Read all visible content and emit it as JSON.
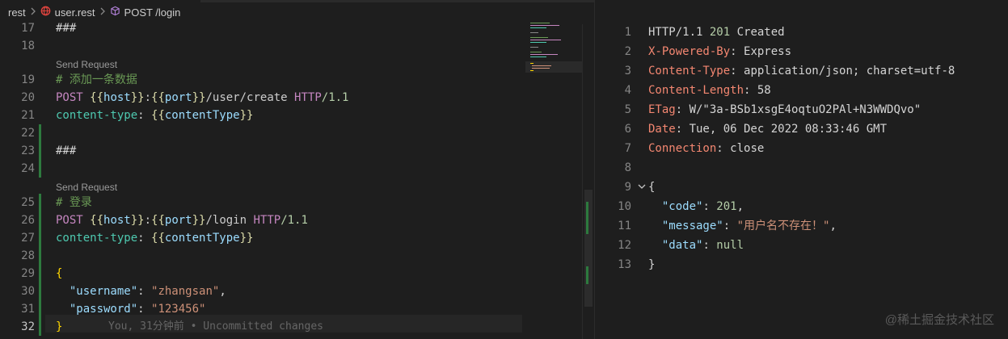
{
  "breadcrumb": {
    "items": [
      "rest",
      "user.rest",
      "POST /login"
    ],
    "icons": [
      "chevron-right-icon",
      "globe-icon",
      "cube-icon"
    ]
  },
  "editor": {
    "lines": [
      {
        "n": "17",
        "segments": [
          {
            "t": "###",
            "c": "punct"
          }
        ]
      },
      {
        "n": "18",
        "segments": []
      },
      {
        "n": "19",
        "segments": [
          {
            "t": "# 添加一条数据",
            "c": "comment"
          }
        ],
        "lens": "Send Request"
      },
      {
        "n": "20",
        "segments": [
          {
            "t": "POST ",
            "c": "kw"
          },
          {
            "t": "{{",
            "c": "var"
          },
          {
            "t": "host",
            "c": "ident"
          },
          {
            "t": "}}",
            "c": "var"
          },
          {
            "t": ":",
            "c": "url"
          },
          {
            "t": "{{",
            "c": "var"
          },
          {
            "t": "port",
            "c": "ident"
          },
          {
            "t": "}}",
            "c": "var"
          },
          {
            "t": "/user/create ",
            "c": "url"
          },
          {
            "t": "HTTP",
            "c": "kw"
          },
          {
            "t": "/1.1",
            "c": "num"
          }
        ]
      },
      {
        "n": "21",
        "segments": [
          {
            "t": "content-type",
            "c": "header"
          },
          {
            "t": ": ",
            "c": "punct"
          },
          {
            "t": "{{",
            "c": "var"
          },
          {
            "t": "contentType",
            "c": "ident"
          },
          {
            "t": "}}",
            "c": "var"
          }
        ]
      },
      {
        "n": "22",
        "segments": []
      },
      {
        "n": "23",
        "segments": [
          {
            "t": "###",
            "c": "punct"
          }
        ]
      },
      {
        "n": "24",
        "segments": []
      },
      {
        "n": "25",
        "segments": [
          {
            "t": "# 登录",
            "c": "comment"
          }
        ],
        "lens": "Send Request"
      },
      {
        "n": "26",
        "segments": [
          {
            "t": "POST ",
            "c": "kw"
          },
          {
            "t": "{{",
            "c": "var"
          },
          {
            "t": "host",
            "c": "ident"
          },
          {
            "t": "}}",
            "c": "var"
          },
          {
            "t": ":",
            "c": "url"
          },
          {
            "t": "{{",
            "c": "var"
          },
          {
            "t": "port",
            "c": "ident"
          },
          {
            "t": "}}",
            "c": "var"
          },
          {
            "t": "/login ",
            "c": "url"
          },
          {
            "t": "HTTP",
            "c": "kw"
          },
          {
            "t": "/1.1",
            "c": "num"
          }
        ]
      },
      {
        "n": "27",
        "segments": [
          {
            "t": "content-type",
            "c": "header"
          },
          {
            "t": ": ",
            "c": "punct"
          },
          {
            "t": "{{",
            "c": "var"
          },
          {
            "t": "contentType",
            "c": "ident"
          },
          {
            "t": "}}",
            "c": "var"
          }
        ]
      },
      {
        "n": "28",
        "segments": []
      },
      {
        "n": "29",
        "segments": [
          {
            "t": "{",
            "c": "brace"
          }
        ]
      },
      {
        "n": "30",
        "segments": [
          {
            "t": "  ",
            "c": "punct"
          },
          {
            "t": "\"username\"",
            "c": "key"
          },
          {
            "t": ": ",
            "c": "punct"
          },
          {
            "t": "\"zhangsan\"",
            "c": "str"
          },
          {
            "t": ",",
            "c": "punct"
          }
        ]
      },
      {
        "n": "31",
        "segments": [
          {
            "t": "  ",
            "c": "punct"
          },
          {
            "t": "\"password\"",
            "c": "key"
          },
          {
            "t": ": ",
            "c": "punct"
          },
          {
            "t": "\"123456\"",
            "c": "str"
          }
        ]
      },
      {
        "n": "32",
        "segments": [
          {
            "t": "}",
            "c": "brace"
          }
        ],
        "active": true,
        "blame": "You, 31分钟前 • Uncommitted changes"
      }
    ]
  },
  "response": {
    "lines": [
      {
        "n": "1",
        "segments": [
          {
            "t": "HTTP/1.1 ",
            "c": "val"
          },
          {
            "t": "201",
            "c": "num"
          },
          {
            "t": " Created",
            "c": "val"
          }
        ]
      },
      {
        "n": "2",
        "segments": [
          {
            "t": "X-Powered-By",
            "c": "hkey"
          },
          {
            "t": ": Express",
            "c": "val"
          }
        ]
      },
      {
        "n": "3",
        "segments": [
          {
            "t": "Content-Type",
            "c": "hkey"
          },
          {
            "t": ": application/json; charset=utf-8",
            "c": "val"
          }
        ]
      },
      {
        "n": "4",
        "segments": [
          {
            "t": "Content-Length",
            "c": "hkey"
          },
          {
            "t": ": 58",
            "c": "val"
          }
        ]
      },
      {
        "n": "5",
        "segments": [
          {
            "t": "ETag",
            "c": "hkey"
          },
          {
            "t": ": W/\"3a-BSb1xsgE4oqtuO2PAl+N3WWDQvo\"",
            "c": "val"
          }
        ]
      },
      {
        "n": "6",
        "segments": [
          {
            "t": "Date",
            "c": "hkey"
          },
          {
            "t": ": Tue, 06 Dec 2022 08:33:46 GMT",
            "c": "val"
          }
        ]
      },
      {
        "n": "7",
        "segments": [
          {
            "t": "Connection",
            "c": "hkey"
          },
          {
            "t": ": close",
            "c": "val"
          }
        ]
      },
      {
        "n": "8",
        "segments": []
      },
      {
        "n": "9",
        "segments": [
          {
            "t": "{",
            "c": "val"
          }
        ],
        "fold": true
      },
      {
        "n": "10",
        "segments": [
          {
            "t": "  ",
            "c": "val"
          },
          {
            "t": "\"code\"",
            "c": "key"
          },
          {
            "t": ": ",
            "c": "val"
          },
          {
            "t": "201",
            "c": "num"
          },
          {
            "t": ",",
            "c": "val"
          }
        ]
      },
      {
        "n": "11",
        "segments": [
          {
            "t": "  ",
            "c": "val"
          },
          {
            "t": "\"message\"",
            "c": "key"
          },
          {
            "t": ": ",
            "c": "val"
          },
          {
            "t": "\"用户名不存在！\"",
            "c": "str"
          },
          {
            "t": ",",
            "c": "val"
          }
        ]
      },
      {
        "n": "12",
        "segments": [
          {
            "t": "  ",
            "c": "val"
          },
          {
            "t": "\"data\"",
            "c": "key"
          },
          {
            "t": ": ",
            "c": "val"
          },
          {
            "t": "null",
            "c": "num"
          }
        ]
      },
      {
        "n": "13",
        "segments": [
          {
            "t": "}",
            "c": "val"
          }
        ]
      }
    ]
  },
  "watermark": "@稀土掘金技术社区",
  "colors": {
    "background": "#1e1e1e",
    "gutter_added": "#2d7a3e",
    "keyword": "#c586c0",
    "string": "#ce9178",
    "header_key": "#f48771"
  }
}
